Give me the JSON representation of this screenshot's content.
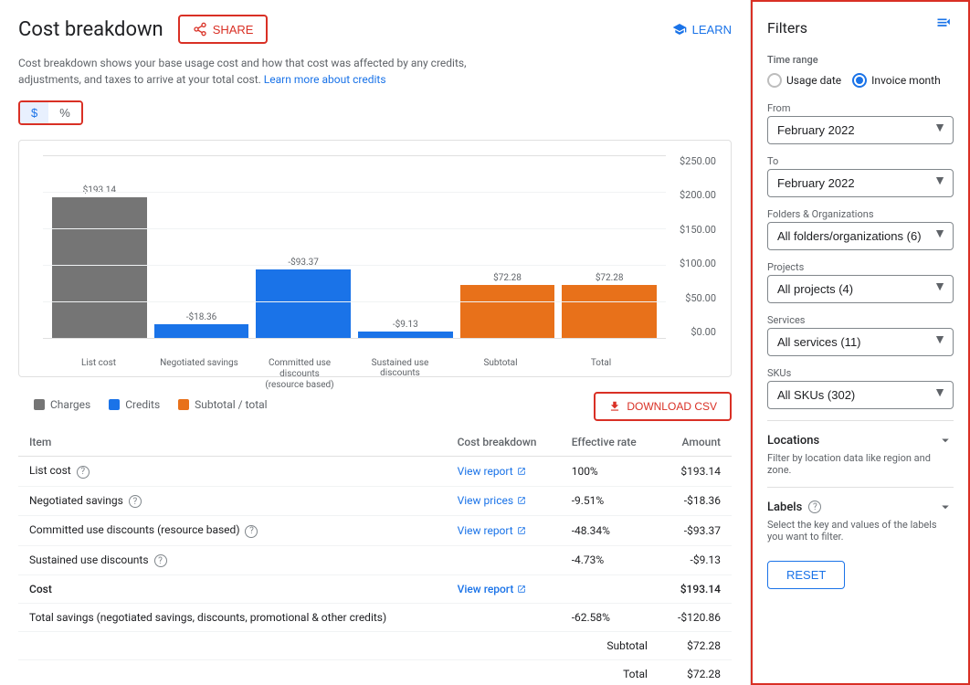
{
  "page": {
    "title": "Cost breakdown",
    "share_label": "SHARE",
    "learn_label": "LEARN",
    "description": "Cost breakdown shows your base usage cost and how that cost was affected by any credits, adjustments, and taxes to arrive at your total cost.",
    "learn_link": "Learn more about credits",
    "toggle_dollar": "$",
    "toggle_percent": "%"
  },
  "chart": {
    "y_labels": [
      "$250.00",
      "$200.00",
      "$150.00",
      "$100.00",
      "$50.00",
      "$0.00"
    ],
    "bars": [
      {
        "label": "List cost",
        "value": "$193.14",
        "amount": 193.14,
        "color": "#757575",
        "type": "positive"
      },
      {
        "label": "Negotiated savings",
        "value": "-$18.36",
        "amount": -18.36,
        "color": "#1a73e8",
        "type": "negative"
      },
      {
        "label": "Committed use discounts\n(resource based)",
        "value": "-$93.37",
        "amount": -93.37,
        "color": "#1a73e8",
        "type": "negative"
      },
      {
        "label": "Sustained use discounts",
        "value": "-$9.13",
        "amount": -9.13,
        "color": "#1a73e8",
        "type": "negative"
      },
      {
        "label": "Subtotal",
        "value": "$72.28",
        "amount": 72.28,
        "color": "#e8711a",
        "type": "positive"
      },
      {
        "label": "Total",
        "value": "$72.28",
        "amount": 72.28,
        "color": "#e8711a",
        "type": "positive"
      }
    ],
    "legend": [
      {
        "label": "Charges",
        "color": "#757575"
      },
      {
        "label": "Credits",
        "color": "#1a73e8"
      },
      {
        "label": "Subtotal / total",
        "color": "#e8711a"
      }
    ]
  },
  "table": {
    "download_label": "DOWNLOAD CSV",
    "headers": [
      "Item",
      "Cost breakdown",
      "Effective rate",
      "Amount"
    ],
    "rows": [
      {
        "item": "List cost",
        "help": true,
        "cost_breakdown": "View report",
        "effective_rate": "100%",
        "amount": "$193.14"
      },
      {
        "item": "Negotiated savings",
        "help": true,
        "cost_breakdown": "View prices",
        "effective_rate": "-9.51%",
        "amount": "-$18.36"
      },
      {
        "item": "Committed use discounts (resource based)",
        "help": true,
        "cost_breakdown": "View report",
        "effective_rate": "-48.34%",
        "amount": "-$93.37"
      },
      {
        "item": "Sustained use discounts",
        "help": true,
        "cost_breakdown": "",
        "effective_rate": "-4.73%",
        "amount": "-$9.13"
      },
      {
        "item": "Cost",
        "help": false,
        "cost_breakdown": "View report",
        "effective_rate": "",
        "amount": "$193.14",
        "bold": true
      },
      {
        "item": "Total savings (negotiated savings, discounts, promotional & other credits)",
        "help": false,
        "cost_breakdown": "",
        "effective_rate": "-62.58%",
        "amount": "-$120.86"
      }
    ],
    "subtotal_label": "Subtotal",
    "subtotal_amount": "$72.28",
    "total_label": "Total",
    "total_amount": "$72.28"
  },
  "filters": {
    "title": "Filters",
    "time_range_label": "Time range",
    "usage_date_label": "Usage date",
    "invoice_month_label": "Invoice month",
    "from_label": "From",
    "from_value": "February 2022",
    "to_label": "To",
    "to_value": "February 2022",
    "folders_label": "Folders & Organizations",
    "folders_value": "All folders/organizations (6)",
    "projects_label": "Projects",
    "projects_value": "All projects (4)",
    "services_label": "Services",
    "services_value": "All services (11)",
    "skus_label": "SKUs",
    "skus_value": "All SKUs (302)",
    "locations_label": "Locations",
    "locations_desc": "Filter by location data like region and zone.",
    "labels_label": "Labels",
    "labels_help": true,
    "labels_desc": "Select the key and values of the labels you want to filter.",
    "reset_label": "RESET"
  }
}
